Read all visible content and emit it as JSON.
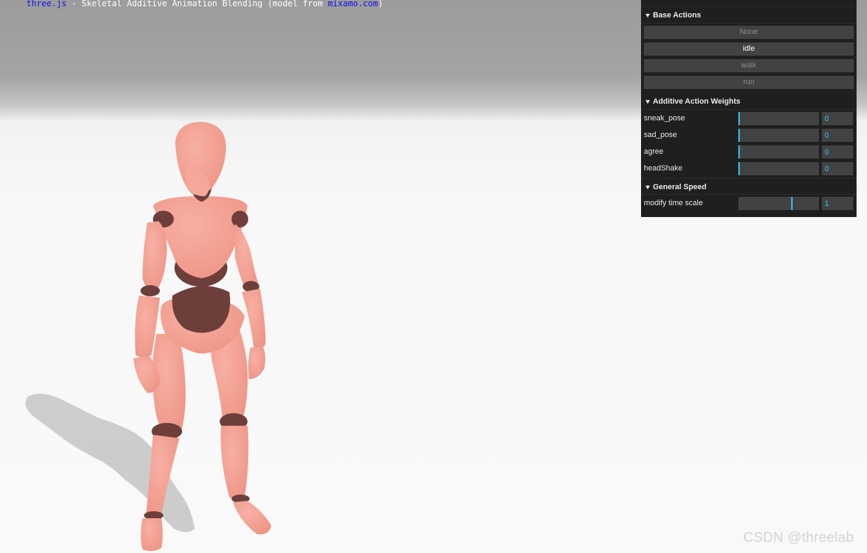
{
  "info": {
    "link_label": "three.js",
    "description": " - Skeletal Additive Animation Blending (model from ",
    "model_link_label": "mixamo.com",
    "close_paren": ")"
  },
  "gui": {
    "base_actions": {
      "title": "Base Actions",
      "buttons": [
        {
          "label": "None",
          "active": false
        },
        {
          "label": "idle",
          "active": true
        },
        {
          "label": "walk",
          "active": false
        },
        {
          "label": "run",
          "active": false
        }
      ]
    },
    "additive_weights": {
      "title": "Additive Action Weights",
      "rows": [
        {
          "label": "sneak_pose",
          "value": "0",
          "fraction": 0
        },
        {
          "label": "sad_pose",
          "value": "0",
          "fraction": 0
        },
        {
          "label": "agree",
          "value": "0",
          "fraction": 0
        },
        {
          "label": "headShake",
          "value": "0",
          "fraction": 0
        }
      ]
    },
    "general_speed": {
      "title": "General Speed",
      "rows": [
        {
          "label": "modify time scale",
          "value": "1",
          "fraction": 0.67
        }
      ]
    }
  },
  "colors": {
    "accent": "#2cc9ff",
    "gui_background": "#1f1f1f",
    "control_background": "#424242",
    "link": "#1010ee",
    "model_skin": "#f4a093",
    "model_joint": "#6e3e3a"
  },
  "watermark": "CSDN @threelab"
}
